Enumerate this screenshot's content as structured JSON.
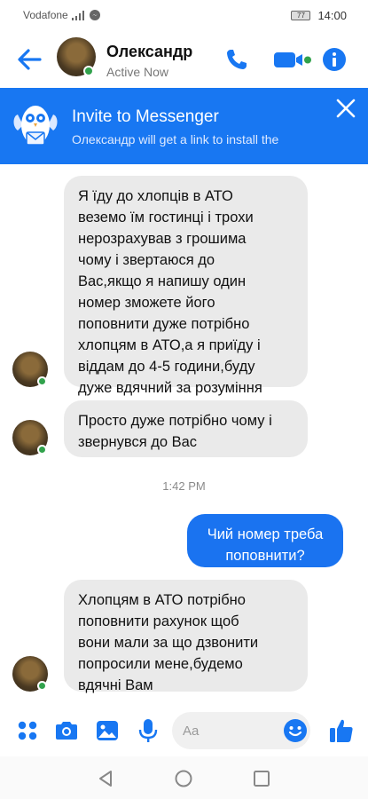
{
  "status_bar": {
    "carrier": "Vodafone",
    "battery": "77",
    "time": "14:00"
  },
  "header": {
    "contact_name": "Олександр",
    "presence": "Active Now"
  },
  "invite_banner": {
    "title": "Invite to Messenger",
    "subtitle": "Олександр will get a link to install the"
  },
  "messages": [
    {
      "direction": "incoming",
      "text": "Я їду до хлопців в АТО\nвеземо їм гостинці і трохи\nнерозрахував з грошима\nчому і звертаюся до\nВас,якщо я напишу один\nномер зможете його\nпоповнити дуже потрібно\nхлопцям в АТО,а я приїду і\nвіддам до 4-5 години,буду\nдуже вдячний за розуміння"
    },
    {
      "direction": "incoming",
      "text": "Просто дуже потрібно чому і\nзвернувся до Вас"
    },
    {
      "direction": "timestamp",
      "text": "1:42 PM"
    },
    {
      "direction": "outgoing",
      "text": "Чий номер треба\nпоповнити?"
    },
    {
      "direction": "incoming",
      "text": "Хлопцям в АТО потрібно\nпоповнити рахунок щоб\nвони мали за що дзвонити\nпопросили мене,будемо\nвдячні Вам"
    }
  ],
  "composer": {
    "placeholder": "Aa"
  },
  "colors": {
    "messenger_blue": "#1877f2",
    "bubble_incoming": "#eaeaea",
    "bubble_outgoing": "#1a73f0",
    "online_green": "#31a24c"
  }
}
